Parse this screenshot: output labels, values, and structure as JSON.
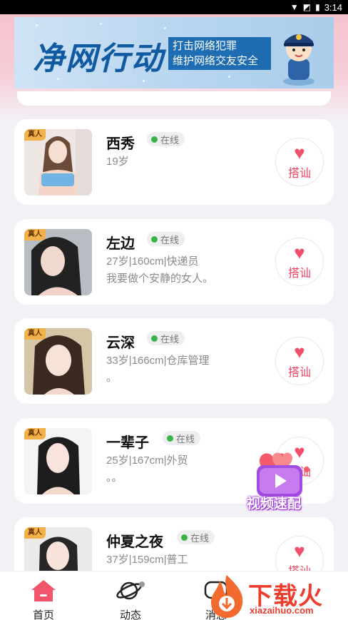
{
  "status_bar": {
    "time": "3:14",
    "icons": [
      "wifi-icon",
      "signal-icon",
      "battery-icon"
    ]
  },
  "banner": {
    "title": "净网行动",
    "sub_line1": "打击网络犯罪",
    "sub_line2": "维护网络交友安全"
  },
  "badge_text": "真人",
  "profiles": [
    {
      "name": "西秀",
      "status": "在线",
      "info1": "19岁",
      "info2": "",
      "action": "搭讪"
    },
    {
      "name": "左边",
      "status": "在线",
      "info1": "27岁|160cm|快递员",
      "info2": "我要做个安静的女人。",
      "action": "搭讪"
    },
    {
      "name": "云深",
      "status": "在线",
      "info1": "33岁|166cm|仓库管理",
      "info2": "。",
      "action": "搭讪"
    },
    {
      "name": "一辈子",
      "status": "在线",
      "info1": "25岁|167cm|外贸",
      "info2": "。。",
      "action": "搭讪"
    },
    {
      "name": "仲夏之夜",
      "status": "在线",
      "info1": "37岁|159cm|普工",
      "info2": "",
      "action": "搭讪"
    }
  ],
  "video_match": {
    "label": "视频速配"
  },
  "tabs": [
    {
      "label": "首页",
      "icon": "home-icon",
      "active": true
    },
    {
      "label": "动态",
      "icon": "planet-icon",
      "active": false
    },
    {
      "label": "消息",
      "icon": "message-icon",
      "active": false
    }
  ],
  "watermark": {
    "text": "下载火",
    "url": "xiazaihuo.com"
  },
  "colors": {
    "accent": "#f0415f",
    "online": "#3ab34a",
    "badge": "#f2b14a",
    "banner_blue": "#1e6db3"
  }
}
